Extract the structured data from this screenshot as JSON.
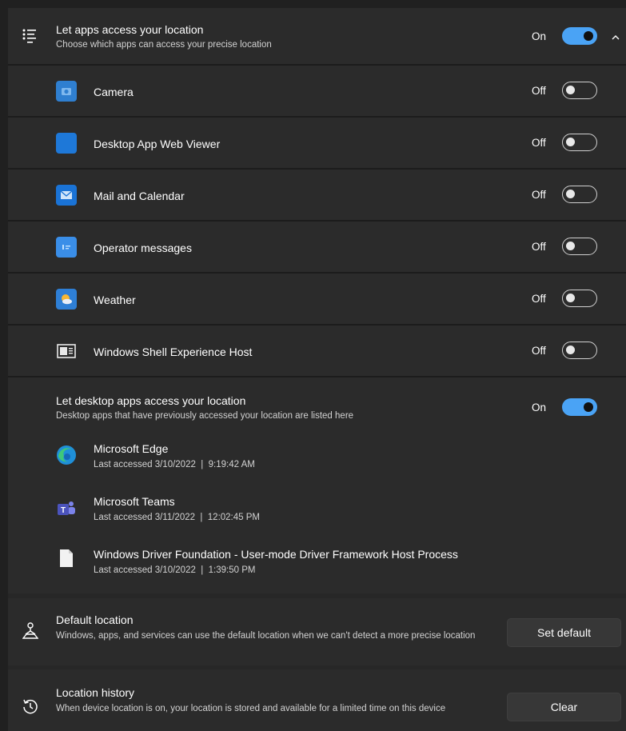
{
  "location_access": {
    "title": "Let apps access your location",
    "subtitle": "Choose which apps can access your precise location",
    "state": "On",
    "enabled": true,
    "icon": "list-icon"
  },
  "apps": [
    {
      "name": "Camera",
      "state": "Off",
      "icon": "camera-icon"
    },
    {
      "name": "Desktop App Web Viewer",
      "state": "Off",
      "icon": "web-viewer-icon"
    },
    {
      "name": "Mail and Calendar",
      "state": "Off",
      "icon": "mail-icon"
    },
    {
      "name": "Operator messages",
      "state": "Off",
      "icon": "operator-messages-icon"
    },
    {
      "name": "Weather",
      "state": "Off",
      "icon": "weather-icon"
    },
    {
      "name": "Windows Shell Experience Host",
      "state": "Off",
      "icon": "shell-host-icon"
    }
  ],
  "desktop_apps": {
    "title": "Let desktop apps access your location",
    "subtitle": "Desktop apps that have previously accessed your location are listed here",
    "state": "On",
    "enabled": true,
    "items": [
      {
        "name": "Microsoft Edge",
        "accessed": "Last accessed 3/10/2022  |  9:19:42 AM",
        "icon": "edge-icon"
      },
      {
        "name": "Microsoft Teams",
        "accessed": "Last accessed 3/11/2022  |  12:02:45 PM",
        "icon": "teams-icon"
      },
      {
        "name": "Windows Driver Foundation - User-mode Driver Framework Host Process",
        "accessed": "Last accessed 3/10/2022  |  1:39:50 PM",
        "icon": "file-icon"
      }
    ]
  },
  "default_location": {
    "title": "Default location",
    "description": "Windows, apps, and services can use the default location when we can't detect a more precise location",
    "button": "Set default",
    "icon": "pin-person-icon"
  },
  "location_history": {
    "title": "Location history",
    "description": "When device location is on, your location is stored and available for a limited time on this device",
    "button": "Clear",
    "icon": "history-icon"
  },
  "colors": {
    "accent": "#4aa3f5",
    "row": "#2b2b2b",
    "background": "#202020"
  }
}
